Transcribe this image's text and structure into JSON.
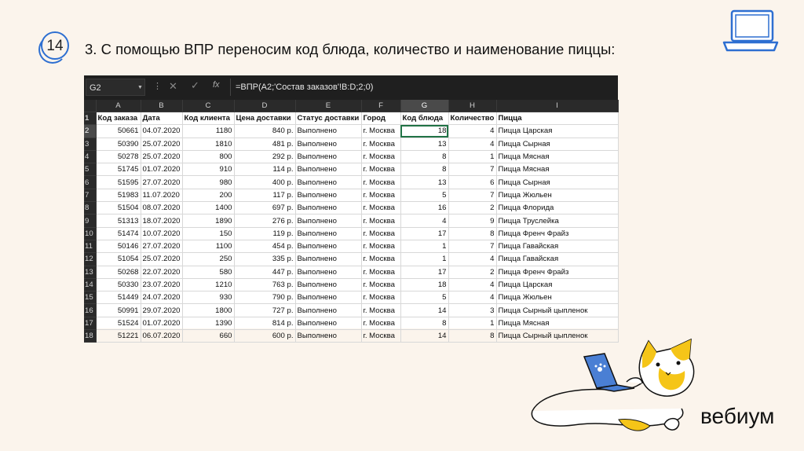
{
  "slide": {
    "number": "14",
    "title": "3. С помощью ВПР переносим код блюда, количество и наименование пиццы:"
  },
  "formula_bar": {
    "name_box": "G2",
    "formula": "=ВПР(A2;'Состав заказов'!B:D;2;0)"
  },
  "columns": [
    "A",
    "B",
    "C",
    "D",
    "E",
    "F",
    "G",
    "H",
    "I"
  ],
  "rows": [
    {
      "n": "1",
      "cells": [
        "Код заказа",
        "Дата",
        "Код клиента",
        "Цена доставки",
        "Статус доставки",
        "Город",
        "Код блюда",
        "Количество",
        "Пицца"
      ]
    },
    {
      "n": "2",
      "cells": [
        "50661",
        "04.07.2020",
        "1180",
        "840 р.",
        "Выполнено",
        "г. Москва",
        "18",
        "4",
        "Пицца Царская"
      ]
    },
    {
      "n": "3",
      "cells": [
        "50390",
        "25.07.2020",
        "1810",
        "481 р.",
        "Выполнено",
        "г. Москва",
        "13",
        "4",
        "Пицца Сырная"
      ]
    },
    {
      "n": "4",
      "cells": [
        "50278",
        "25.07.2020",
        "800",
        "292 р.",
        "Выполнено",
        "г. Москва",
        "8",
        "1",
        "Пицца Мясная"
      ]
    },
    {
      "n": "5",
      "cells": [
        "51745",
        "01.07.2020",
        "910",
        "114 р.",
        "Выполнено",
        "г. Москва",
        "8",
        "7",
        "Пицца Мясная"
      ]
    },
    {
      "n": "6",
      "cells": [
        "51595",
        "27.07.2020",
        "980",
        "400 р.",
        "Выполнено",
        "г. Москва",
        "13",
        "6",
        "Пицца Сырная"
      ]
    },
    {
      "n": "7",
      "cells": [
        "51983",
        "11.07.2020",
        "200",
        "117 р.",
        "Выполнено",
        "г. Москва",
        "5",
        "7",
        "Пицца Жюльен"
      ]
    },
    {
      "n": "8",
      "cells": [
        "51504",
        "08.07.2020",
        "1400",
        "697 р.",
        "Выполнено",
        "г. Москва",
        "16",
        "2",
        "Пицца Флорида"
      ]
    },
    {
      "n": "9",
      "cells": [
        "51313",
        "18.07.2020",
        "1890",
        "276 р.",
        "Выполнено",
        "г. Москва",
        "4",
        "9",
        "Пицца Труслейка"
      ]
    },
    {
      "n": "10",
      "cells": [
        "51474",
        "10.07.2020",
        "150",
        "119 р.",
        "Выполнено",
        "г. Москва",
        "17",
        "8",
        "Пицца Френч Фрайз"
      ]
    },
    {
      "n": "11",
      "cells": [
        "50146",
        "27.07.2020",
        "1100",
        "454 р.",
        "Выполнено",
        "г. Москва",
        "1",
        "7",
        "Пицца Гавайская"
      ]
    },
    {
      "n": "12",
      "cells": [
        "51054",
        "25.07.2020",
        "250",
        "335 р.",
        "Выполнено",
        "г. Москва",
        "1",
        "4",
        "Пицца Гавайская"
      ]
    },
    {
      "n": "13",
      "cells": [
        "50268",
        "22.07.2020",
        "580",
        "447 р.",
        "Выполнено",
        "г. Москва",
        "17",
        "2",
        "Пицца Френч Фрайз"
      ]
    },
    {
      "n": "14",
      "cells": [
        "50330",
        "23.07.2020",
        "1210",
        "763 р.",
        "Выполнено",
        "г. Москва",
        "18",
        "4",
        "Пицца Царская"
      ]
    },
    {
      "n": "15",
      "cells": [
        "51449",
        "24.07.2020",
        "930",
        "790 р.",
        "Выполнено",
        "г. Москва",
        "5",
        "4",
        "Пицца Жюльен"
      ]
    },
    {
      "n": "16",
      "cells": [
        "50991",
        "29.07.2020",
        "1800",
        "727 р.",
        "Выполнено",
        "г. Москва",
        "14",
        "3",
        "Пицца Сырный цыпленок"
      ]
    },
    {
      "n": "17",
      "cells": [
        "51524",
        "01.07.2020",
        "1390",
        "814 р.",
        "Выполнено",
        "г. Москва",
        "8",
        "1",
        "Пицца Мясная"
      ]
    },
    {
      "n": "18",
      "cells": [
        "51221",
        "06.07.2020",
        "660",
        "600 р.",
        "Выполнено",
        "г. Москва",
        "14",
        "8",
        "Пицца Сырный цыпленок"
      ]
    }
  ],
  "brand": {
    "name": "вебиум"
  },
  "colors": {
    "accent": "#2e6fd1",
    "cat_yellow": "#f5c518",
    "excel_green": "#217346"
  }
}
